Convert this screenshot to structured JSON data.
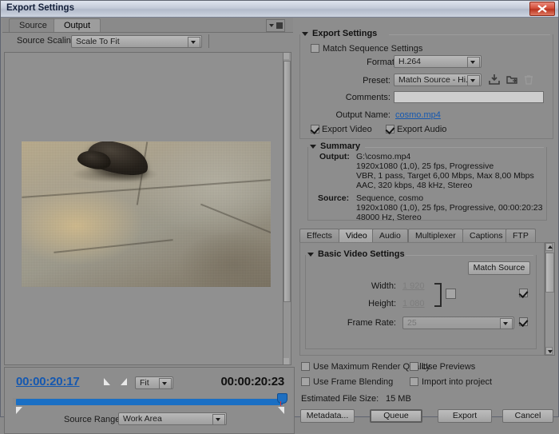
{
  "window": {
    "title": "Export Settings",
    "close_icon": "close-icon"
  },
  "left_panel": {
    "tabs": [
      {
        "label": "Source",
        "active": false
      },
      {
        "label": "Output",
        "active": true
      }
    ],
    "panel_menu_icon": "panel-menu-icon",
    "source_scaling": {
      "label": "Source Scaling:",
      "value": "Scale To Fit"
    },
    "preview": {
      "description": "Video frame preview: dark shoe on cracked concrete pavement"
    },
    "timeline": {
      "current_timecode": "00:00:20:17",
      "duration_timecode": "00:00:20:23",
      "zoom_value": "Fit",
      "set_in_icon": "set-in-point-icon",
      "set_out_icon": "set-out-point-icon",
      "source_range_label": "Source Range:",
      "source_range_value": "Work Area"
    }
  },
  "right_panel": {
    "export_settings": {
      "title": "Export Settings",
      "match_sequence_settings": {
        "label": "Match Sequence Settings",
        "checked": false
      },
      "format": {
        "label": "Format:",
        "value": "H.264"
      },
      "preset": {
        "label": "Preset:",
        "value": "Match Source - Hi..."
      },
      "preset_icons": [
        "save-preset-icon",
        "import-preset-icon",
        "delete-preset-icon"
      ],
      "comments": {
        "label": "Comments:",
        "value": "",
        "placeholder": ""
      },
      "output_name": {
        "label": "Output Name:",
        "value": "cosmo.mp4"
      },
      "export_video": {
        "label": "Export Video",
        "checked": true
      },
      "export_audio": {
        "label": "Export Audio",
        "checked": true
      }
    },
    "summary": {
      "title": "Summary",
      "output_label": "Output:",
      "output_lines": [
        "G:\\cosmo.mp4",
        "1920x1080 (1,0), 25 fps, Progressive",
        "VBR, 1 pass, Target 6,00 Mbps, Max 8,00 Mbps",
        "AAC, 320 kbps, 48 kHz, Stereo"
      ],
      "source_label": "Source:",
      "source_lines": [
        "Sequence, cosmo",
        "1920x1080 (1,0), 25 fps, Progressive, 00:00:20:23",
        "48000 Hz, Stereo"
      ]
    },
    "tabs": [
      {
        "label": "Effects",
        "active": false
      },
      {
        "label": "Video",
        "active": true
      },
      {
        "label": "Audio",
        "active": false
      },
      {
        "label": "Multiplexer",
        "active": false
      },
      {
        "label": "Captions",
        "active": false
      },
      {
        "label": "FTP",
        "active": false
      }
    ],
    "basic_video_settings": {
      "title": "Basic Video Settings",
      "match_source_button": "Match Source",
      "width": {
        "label": "Width:",
        "value": "1 920",
        "checked": true
      },
      "height": {
        "label": "Height:",
        "value": "1 080"
      },
      "link_checkbox_checked": false,
      "frame_rate": {
        "label": "Frame Rate:",
        "value": "25",
        "checked": true
      }
    },
    "options": {
      "use_maximum_render_quality": {
        "label": "Use Maximum Render Quality",
        "checked": false
      },
      "use_previews": {
        "label": "Use Previews",
        "checked": false
      },
      "use_frame_blending": {
        "label": "Use Frame Blending",
        "checked": false
      },
      "import_into_project": {
        "label": "Import into project",
        "checked": false
      }
    },
    "estimated_file_size": {
      "label": "Estimated File Size:",
      "value": "15 MB"
    },
    "buttons": {
      "metadata": "Metadata...",
      "queue": "Queue",
      "export": "Export",
      "cancel": "Cancel"
    }
  },
  "colors": {
    "accent_blue": "#1a6fc4",
    "link_blue": "#1558b0",
    "panel_gray": "#8d8d8d",
    "close_red": "#d4503c"
  }
}
